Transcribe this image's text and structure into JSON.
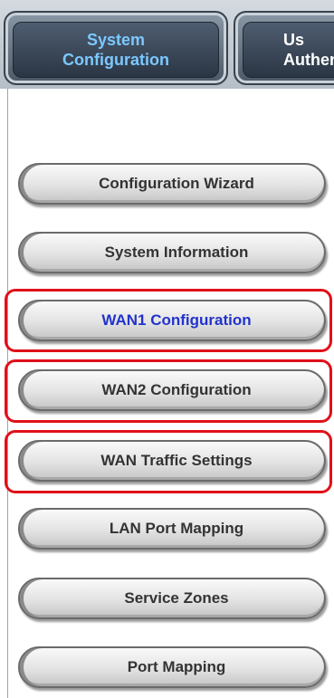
{
  "tabs": {
    "system": {
      "line1": "System",
      "line2": "Configuration"
    },
    "user": {
      "line1": "Us",
      "line2": "Authen"
    }
  },
  "menu": {
    "items": [
      {
        "label": "Configuration Wizard",
        "active": false,
        "highlighted": false
      },
      {
        "label": "System Information",
        "active": false,
        "highlighted": false
      },
      {
        "label": "WAN1 Configuration",
        "active": true,
        "highlighted": true
      },
      {
        "label": "WAN2 Configuration",
        "active": false,
        "highlighted": true
      },
      {
        "label": "WAN Traffic Settings",
        "active": false,
        "highlighted": true
      },
      {
        "label": "LAN Port Mapping",
        "active": false,
        "highlighted": false
      },
      {
        "label": "Service Zones",
        "active": false,
        "highlighted": false
      },
      {
        "label": "Port Mapping",
        "active": false,
        "highlighted": false
      }
    ]
  },
  "colors": {
    "active_text": "#2233cc",
    "highlight_border": "#e0101a",
    "tab_active_text": "#7cc8ff"
  }
}
